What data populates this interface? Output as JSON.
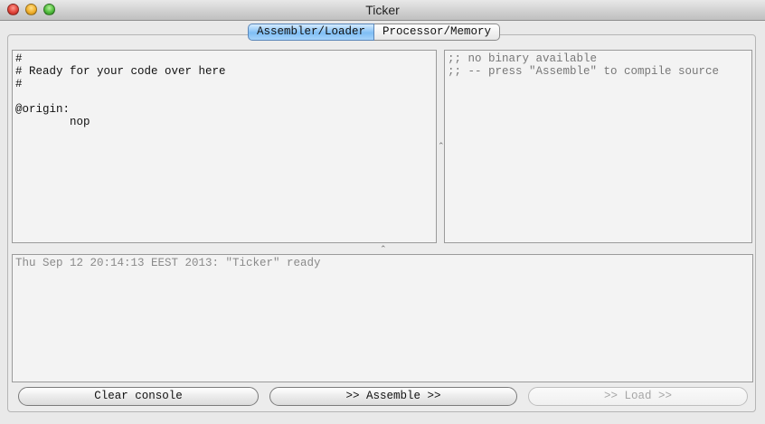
{
  "window": {
    "title": "Ticker"
  },
  "tabs": [
    {
      "label": "Assembler/Loader",
      "active": true
    },
    {
      "label": "Processor/Memory",
      "active": false
    }
  ],
  "editor": {
    "text": "#\n# Ready for your code over here\n#\n\n@origin:\n        nop"
  },
  "binary": {
    "text": ";; no binary available\n;; -- press \"Assemble\" to compile source"
  },
  "console": {
    "text": "Thu Sep 12 20:14:13 EEST 2013: \"Ticker\" ready"
  },
  "buttons": {
    "clear_label": "Clear console",
    "assemble_label": ">> Assemble >>",
    "load_label": ">> Load >>",
    "load_enabled": false
  },
  "colors": {
    "active_tab": "#7fbef5",
    "close_light": "#e0443a",
    "minimize_light": "#f0b02c",
    "zoom_light": "#4fbb3c"
  }
}
